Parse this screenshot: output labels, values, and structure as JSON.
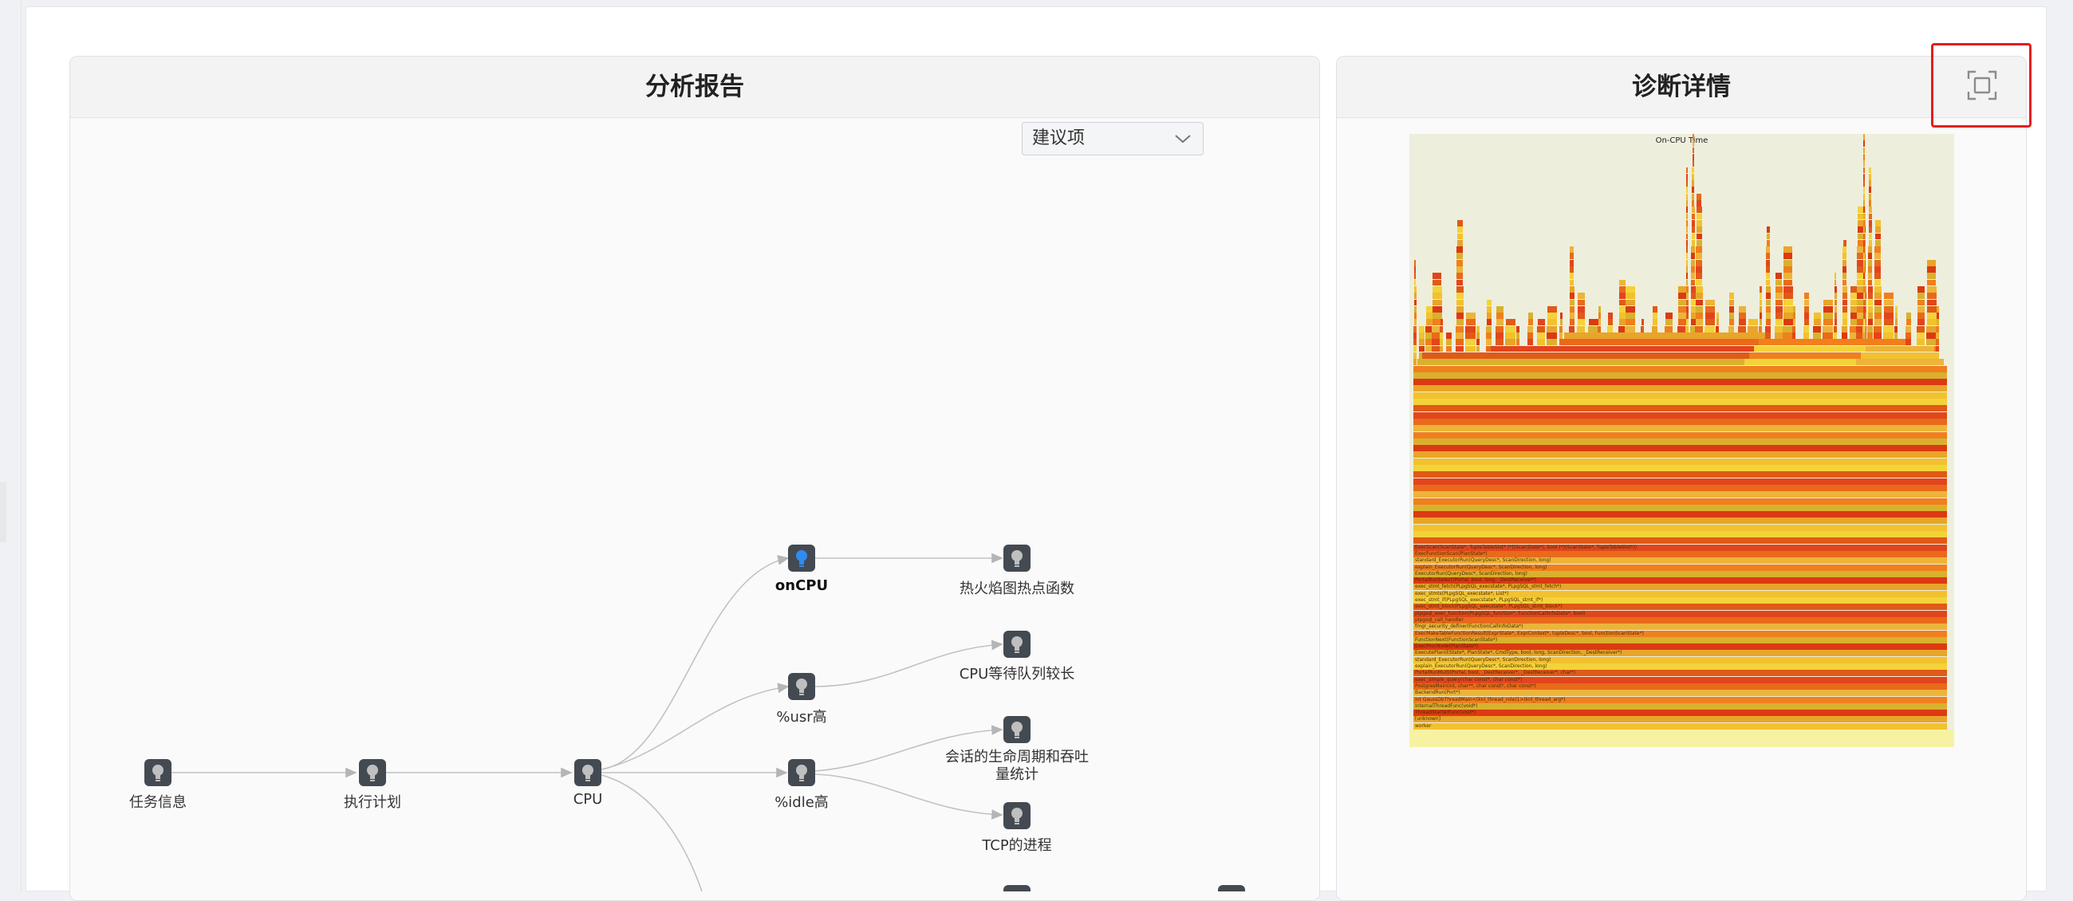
{
  "left_panel": {
    "title": "分析报告",
    "filter_select": {
      "value": "建议项"
    },
    "nodes": [
      {
        "id": "task-info",
        "label": "任务信息"
      },
      {
        "id": "exec-plan",
        "label": "执行计划"
      },
      {
        "id": "cpu",
        "label": "CPU"
      },
      {
        "id": "oncpu",
        "label": "onCPU",
        "bold": true
      },
      {
        "id": "usr-high",
        "label": "%usr高"
      },
      {
        "id": "idle-high",
        "label": "%idle高"
      },
      {
        "id": "flame-hot",
        "label": "热火焰图热点函数"
      },
      {
        "id": "cpu-queue",
        "label": "CPU等待队列较长"
      },
      {
        "id": "session-life",
        "label": "会话的生命周期和吞吐量统计"
      },
      {
        "id": "tcp-process",
        "label": "TCP的进程"
      }
    ]
  },
  "right_panel": {
    "title": "诊断详情",
    "fullscreen_icon": "fullscreen-icon",
    "flamegraph": {
      "title": "On-CPU Time",
      "frames": [
        "ExecScan(ScanState*, TupleTableSlot* (*)(ScanState*), bool (*)(ScanState*, TupleTableSlot*))",
        "ExecFunctionScan(PlanState*)",
        "standard_ExecutorRun(QueryDesc*, ScanDirection, long)",
        "explain_ExecutorRun(QueryDesc*, ScanDirection, long)",
        "ExecutorRun(QueryDesc*, ScanDirection, long)",
        "PortalRunSelect(Portal, bool, long, _DestReceiver*)",
        "exec_stmt_fetch(PLpgSQL_execstate*, PLpgSQL_stmt_fetch*)",
        "exec_stmts(PLpgSQL_execstate*, List*)",
        "exec_stmt_if(PLpgSQL_execstate*, PLpgSQL_stmt_if*)",
        "exec_stmt_block(PLpgSQL_execstate*, PLpgSQL_stmt_block*)",
        "plpgsql_exec_function(PLpgSQL_function*, FunctionCallInfoData*, bool)",
        "plpgsql_call_handler",
        "fmgr_security_definer(FunctionCallInfoData*)",
        "ExecMakeTableFunctionResult(ExprState*, ExprContext*, tupleDesc*, bool, FunctionScanState*)",
        "FunctionNext(FunctionScanState*)",
        "ExecProcNode(PlanState*)",
        "ExecutePlan(EState*, PlanState*, CmdType, bool, long, ScanDirection, _DestReceiver*)",
        "standard_ExecutorRun(QueryDesc*, ScanDirection, long)",
        "explain_ExecutorRun(QueryDesc*, ScanDirection, long)",
        "PortalRunMulti(Portal, bool, _DestReceiver*, _DestReceiver*, char*)",
        "exec_simple_query(char const*, char const*)",
        "PostgresMain(int, char**, char const*, char const*)",
        "BackendRun(Port*)",
        "int GaussDbThreadMain<(knl_thread_role)1>(knl_thread_arg*)",
        "InternalThreadFunc(void*)",
        "ThreadStarterFunc(void*)",
        "[unknown]",
        "worker"
      ]
    }
  }
}
